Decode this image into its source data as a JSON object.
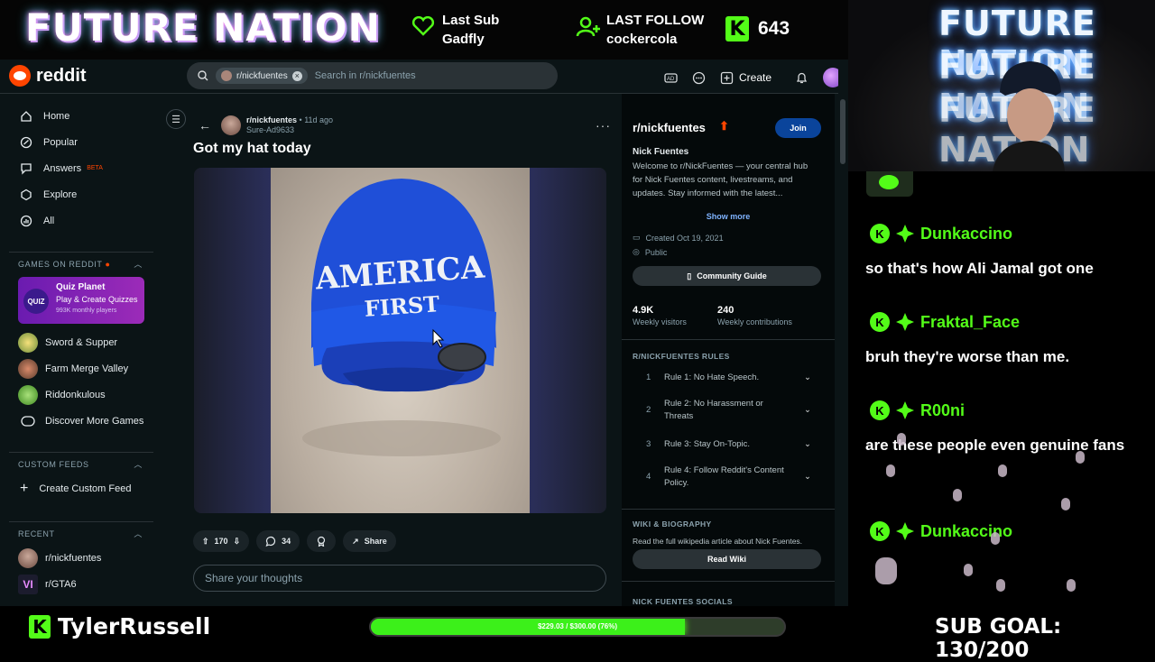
{
  "overlay": {
    "channel_logo": "FUTURE NATION",
    "last_sub_label": "Last Sub",
    "last_sub_name": "Gadfly",
    "last_follow_label": "LAST FOLLOW",
    "last_follow_name": "cockercola",
    "follower_count": "643",
    "streamer_name": "TylerRussell",
    "goal_text": "$229.03 / $300.00 (76%)",
    "goal_fraction": 0.76,
    "sub_goal": "SUB GOAL: 130/200",
    "neon_sign": "FUTURE NATION"
  },
  "colors": {
    "kick_green": "#53fc18",
    "reddit_orange": "#ff4500",
    "join_blue": "#0a449b",
    "reddit_bg": "#0b1416"
  },
  "reddit": {
    "logo": "reddit",
    "search_chip": "r/nickfuentes",
    "search_placeholder": "Search in r/nickfuentes",
    "create_label": "Create",
    "nav": [
      {
        "label": "Home",
        "icon": "home-icon"
      },
      {
        "label": "Popular",
        "icon": "popular-icon"
      },
      {
        "label": "Answers",
        "icon": "answers-icon",
        "badge": "BETA"
      },
      {
        "label": "Explore",
        "icon": "explore-icon"
      },
      {
        "label": "All",
        "icon": "all-icon"
      }
    ],
    "games_section": "GAMES ON REDDIT",
    "quiz": {
      "logo": "QUIZ",
      "title": "Quiz Planet",
      "subtitle": "Play & Create Quizzes",
      "players": "993K monthly players"
    },
    "games": [
      "Sword & Supper",
      "Farm Merge Valley",
      "Riddonkulous",
      "Discover More Games"
    ],
    "custom_section": "CUSTOM FEEDS",
    "create_feed": "Create Custom Feed",
    "recent_section": "RECENT",
    "recent": [
      "r/nickfuentes",
      "r/GTA6"
    ],
    "post": {
      "subreddit": "r/nickfuentes",
      "age": "• 11d ago",
      "author": "Sure-Ad9633",
      "title": "Got my hat today",
      "hat_text_1": "AMERICA",
      "hat_text_2": "FIRST",
      "upvotes": "170",
      "comments": "34",
      "share": "Share",
      "comment_placeholder": "Share your thoughts"
    },
    "sidebar": {
      "name": "r/nickfuentes",
      "join": "Join",
      "heading": "Nick Fuentes",
      "description": "Welcome to r/NickFuentes — your central hub for Nick Fuentes content, livestreams, and updates. Stay informed with the latest...",
      "show_more": "Show more",
      "created": "Created Oct 19, 2021",
      "visibility": "Public",
      "guide": "Community Guide",
      "visitors": "4.9K",
      "visitors_label": "Weekly visitors",
      "contributions": "240",
      "contributions_label": "Weekly contributions",
      "rules_title": "R/NICKFUENTES RULES",
      "rules": [
        {
          "n": "1",
          "text": "Rule 1: No Hate Speech."
        },
        {
          "n": "2",
          "text": "Rule 2: No Harassment or Threats"
        },
        {
          "n": "3",
          "text": "Rule 3: Stay On-Topic."
        },
        {
          "n": "4",
          "text": "Rule 4: Follow Reddit's Content Policy."
        }
      ],
      "wiki_title": "WIKI & BIOGRAPHY",
      "wiki_text": "Read the full wikipedia article about Nick Fuentes.",
      "read_wiki": "Read Wiki",
      "socials_title": "NICK FUENTES SOCIALS"
    }
  },
  "chat": [
    {
      "user": "Dunkaccino",
      "message": "so that's how Ali Jamal got one"
    },
    {
      "user": "Fraktal_Face",
      "message": "bruh they're worse than me."
    },
    {
      "user": "R00ni",
      "message": "are these people even genuine fans"
    },
    {
      "user": "Dunkaccino",
      "message": ""
    }
  ]
}
